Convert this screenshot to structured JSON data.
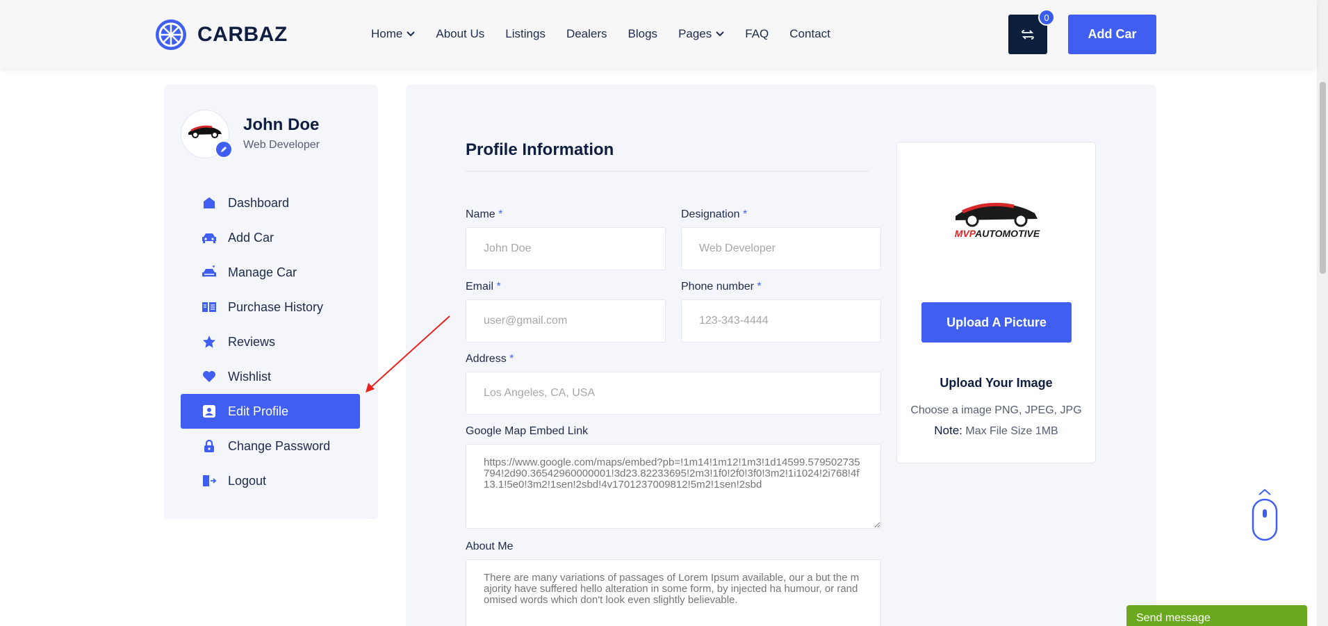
{
  "brand": {
    "name": "CARBAZ"
  },
  "nav": {
    "items": [
      {
        "label": "Home",
        "dropdown": true
      },
      {
        "label": "About Us",
        "dropdown": false
      },
      {
        "label": "Listings",
        "dropdown": false
      },
      {
        "label": "Dealers",
        "dropdown": false
      },
      {
        "label": "Blogs",
        "dropdown": false
      },
      {
        "label": "Pages",
        "dropdown": true
      },
      {
        "label": "FAQ",
        "dropdown": false
      },
      {
        "label": "Contact",
        "dropdown": false
      }
    ],
    "compare_count": "0",
    "add_car_label": "Add Car"
  },
  "sidebar": {
    "user_name": "John Doe",
    "user_role": "Web Developer",
    "avatar_logo_text": "MVPAUTOMOTIVE",
    "menu": [
      {
        "label": "Dashboard",
        "icon": "dashboard-icon",
        "active": false
      },
      {
        "label": "Add Car",
        "icon": "car-icon",
        "active": false
      },
      {
        "label": "Manage Car",
        "icon": "manage-car-icon",
        "active": false
      },
      {
        "label": "Purchase History",
        "icon": "purchase-history-icon",
        "active": false
      },
      {
        "label": "Reviews",
        "icon": "star-icon",
        "active": false
      },
      {
        "label": "Wishlist",
        "icon": "heart-icon",
        "active": false
      },
      {
        "label": "Edit Profile",
        "icon": "profile-icon",
        "active": true
      },
      {
        "label": "Change Password",
        "icon": "lock-icon",
        "active": false
      },
      {
        "label": "Logout",
        "icon": "logout-icon",
        "active": false
      }
    ]
  },
  "form": {
    "title": "Profile Information",
    "name_label": "Name",
    "name_placeholder": "John Doe",
    "designation_label": "Designation",
    "designation_placeholder": "Web Developer",
    "email_label": "Email",
    "email_placeholder": "user@gmail.com",
    "phone_label": "Phone number",
    "phone_placeholder": "123-343-4444",
    "address_label": "Address",
    "address_placeholder": "Los Angeles, CA, USA",
    "map_label": "Google Map Embed Link",
    "map_placeholder": "https://www.google.com/maps/embed?pb=!1m14!1m12!1m3!1d14599.579502735794!2d90.36542960000001!3d23.82233695!2m3!1f0!2f0!3f0!3m2!1i1024!2i768!4f13.1!5e0!3m2!1sen!2sbd!4v1701237009812!5m2!1sen!2sbd",
    "about_label": "About Me",
    "about_placeholder": "There are many variations of passages of Lorem Ipsum available, our a but the majority have suffered hello alteration in some form, by injected ha humour, or randomised words which don't look even slightly believable.",
    "required_mark": "*"
  },
  "upload": {
    "logo_text": "MVPAUTOMOTIVE",
    "button_label": "Upload A Picture",
    "title": "Upload Your Image",
    "hint": "Choose a image PNG, JPEG, JPG",
    "note_label": "Note:",
    "note_text": "Max File Size 1MB"
  },
  "chat": {
    "send_message_label": "Send message"
  },
  "colors": {
    "accent": "#405ff2",
    "dark": "#0b1e3c",
    "chat": "#6aa81e",
    "annotation": "#e8231f"
  }
}
